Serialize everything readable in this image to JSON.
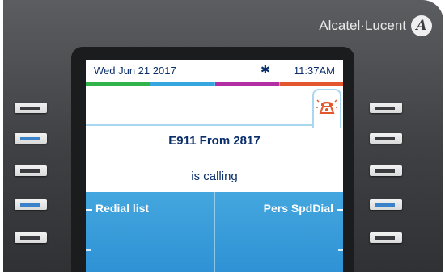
{
  "brand": {
    "name": "Alcatel·Lucent",
    "logo_letter": "A"
  },
  "status_bar": {
    "date": "Wed Jun 21 2017",
    "bluetooth_icon": "bluetooth-icon",
    "time": "11:37AM"
  },
  "tab_strip_colors": [
    "#2fb34a",
    "#35a6de",
    "#b22ea3",
    "#e4572e"
  ],
  "call": {
    "caller": "E911 From 2817",
    "status": "is calling",
    "ring_icon": "ringing-phone-icon"
  },
  "softkeys": {
    "left": "Redial list",
    "right": "Pers SpdDial"
  },
  "side_keys": {
    "left": [
      "line-key",
      "line-key",
      "line-key",
      "line-key",
      "line-key"
    ],
    "right": [
      "line-key",
      "line-key",
      "line-key",
      "line-key",
      "line-key"
    ]
  },
  "colors": {
    "screen_blue": "#4fb0e2",
    "text_navy": "#0b2f6b",
    "alert_red": "#e4572e"
  }
}
